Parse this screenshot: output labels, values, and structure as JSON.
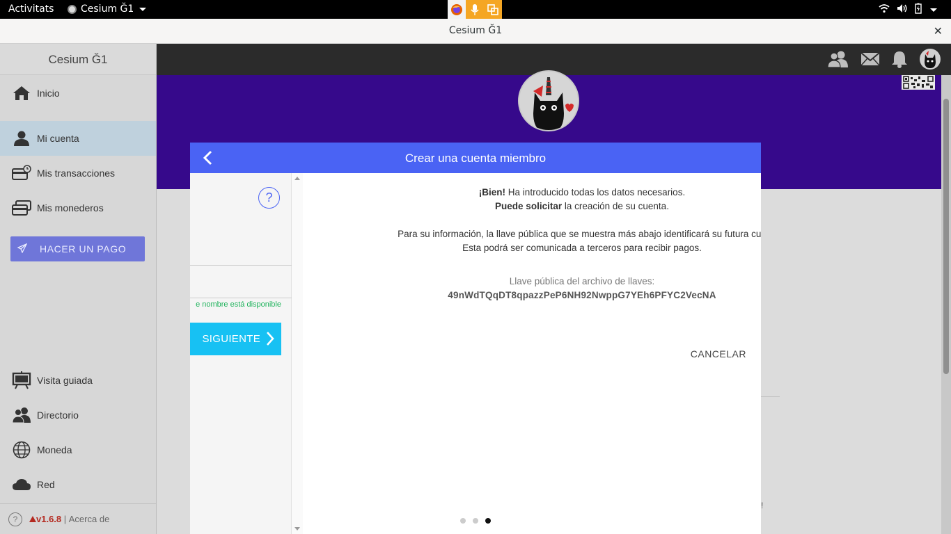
{
  "system_bar": {
    "activities": "Activitats",
    "app_name": "Cesium Ğ1"
  },
  "window": {
    "title": "Cesium Ğ1",
    "close_glyph": "✕"
  },
  "sidebar": {
    "brand": "Cesium Ğ1",
    "items": [
      {
        "label": "Inicio",
        "icon": "home-icon"
      },
      {
        "label": "Mi cuenta",
        "icon": "user-icon",
        "active": true
      },
      {
        "label": "Mis transacciones",
        "icon": "transactions-icon"
      },
      {
        "label": "Mis monederos",
        "icon": "wallets-icon"
      }
    ],
    "pay_button": "HACER UN PAGO",
    "bottom_items": [
      {
        "label": "Visita guiada",
        "icon": "easel-icon"
      },
      {
        "label": "Directorio",
        "icon": "people-icon"
      },
      {
        "label": "Moneda",
        "icon": "globe-icon"
      },
      {
        "label": "Red",
        "icon": "cloud-icon"
      }
    ],
    "footer": {
      "help": "?",
      "version": "v1.6.8",
      "separator": " | ",
      "about": "Acerca de"
    }
  },
  "modal": {
    "title": "Crear una cuenta miembro",
    "prev_slide": {
      "help": "?",
      "availability": "e nombre está disponible",
      "next_button": "SIGUIENTE"
    },
    "slide": {
      "line1_bold": "¡Bien!",
      "line1_rest": " Ha introducido todas los datos necesarios.",
      "line2_bold": "Puede solicitar",
      "line2_rest": " la creación de su cuenta.",
      "info_line1": "Para su información, la llave pública que se muestra más abajo identificará su futura cue",
      "info_line2": "Esta podrá ser comunicada a terceros para recibir pagos.",
      "pubkey_label": "Llave pública del archivo de llaves:",
      "pubkey_value": "49nWdTQqDT8qpazzPeP6NH92NwppG7YEh6PFYC2VecNA",
      "cancel": "CANCELAR"
    },
    "pager": {
      "count": 3,
      "active": 3
    }
  },
  "background": {
    "bang": "!"
  },
  "colors": {
    "modal_header": "#4a63f4",
    "next_button": "#17c1f3",
    "pay_button": "#6f76d9",
    "profile_band": "#36098b",
    "available": "#1fb35c",
    "version": "#b4291f"
  }
}
